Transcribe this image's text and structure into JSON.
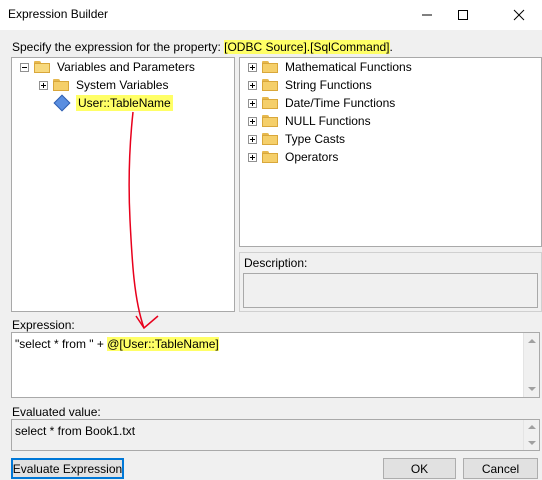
{
  "window": {
    "title": "Expression Builder"
  },
  "prompt": {
    "prefix": "Specify the expression for the property: ",
    "property": "[ODBC Source].[SqlCommand]",
    "suffix": "."
  },
  "variables_tree": {
    "root": "Variables and Parameters",
    "children": [
      {
        "label": "System Variables"
      },
      {
        "label": "User::TableName"
      }
    ]
  },
  "functions_tree": {
    "items": [
      "Mathematical Functions",
      "String Functions",
      "Date/Time Functions",
      "NULL Functions",
      "Type Casts",
      "Operators"
    ]
  },
  "description": {
    "label": "Description:"
  },
  "expression": {
    "label": "Expression:",
    "text_prefix": "\"select * from \" + ",
    "text_variable": "@[User::TableName]"
  },
  "evaluated": {
    "label": "Evaluated value:",
    "value": "select * from Book1.txt"
  },
  "buttons": {
    "evaluate": "Evaluate Expression",
    "ok": "OK",
    "cancel": "Cancel"
  },
  "colors": {
    "highlight": "#ffff66",
    "annotation_arrow": "#e8001c"
  }
}
